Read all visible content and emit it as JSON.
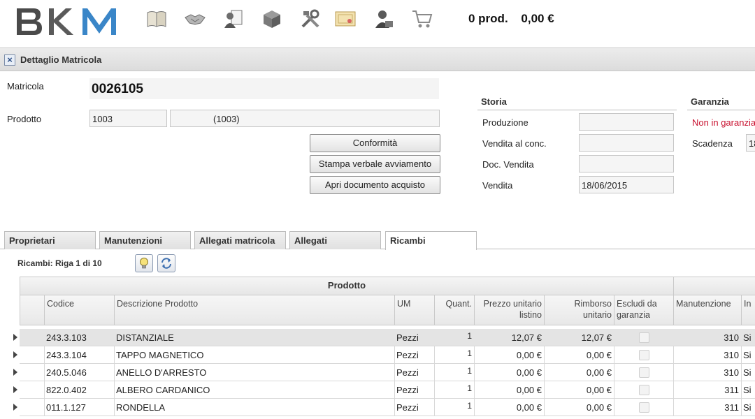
{
  "header": {
    "logo_text": "BKM",
    "nav_icons": [
      "catalog-book-icon",
      "handshake-icon",
      "document-person-icon",
      "box-icon",
      "tools-icon",
      "certificate-icon",
      "support-agent-icon",
      "cart-icon"
    ],
    "cart_count": "0 prod.",
    "cart_total": "0,00 €"
  },
  "window": {
    "title": "Dettaglio Matricola"
  },
  "detail": {
    "matricola_label": "Matricola",
    "matricola_value": "0026105",
    "prodotto_label": "Prodotto",
    "prodotto_code": "1003",
    "prodotto_desc": "(1003)"
  },
  "buttons": {
    "conformita": "Conformità",
    "stampa": "Stampa verbale avviamento",
    "apri": "Apri documento acquisto"
  },
  "storia": {
    "title": "Storia",
    "produzione_label": "Produzione",
    "produzione_value": "",
    "vendita_conc_label": "Vendita al conc.",
    "vendita_conc_value": "",
    "doc_vendita_label": "Doc. Vendita",
    "doc_vendita_value": "",
    "vendita_label": "Vendita",
    "vendita_value": "18/06/2015"
  },
  "garanzia": {
    "title": "Garanzia",
    "status": "Non in garanzia",
    "scadenza_label": "Scadenza",
    "scadenza_value": "18"
  },
  "tabs": [
    "Proprietari",
    "Manutenzioni",
    "Allegati matricola",
    "Allegati",
    "Ricambi"
  ],
  "active_tab": "Ricambi",
  "grid": {
    "title": "Ricambi: Riga 1 di 10",
    "group_header": "Prodotto",
    "columns": {
      "codice": "Codice",
      "descrizione": "Descrizione Prodotto",
      "um": "UM",
      "quant": "Quant.",
      "prezzo": "Prezzo unitario listino",
      "rimborso": "Rimborso unitario",
      "escludi": "Escludi da garanzia",
      "manutenzione": "Manutenzione",
      "in": "In"
    },
    "rows": [
      {
        "codice": "243.3.103",
        "descrizione": "DISTANZIALE",
        "um": "Pezzi",
        "quant": "1",
        "prezzo": "12,07 €",
        "rimborso": "12,07 €",
        "manutenzione": "310",
        "in": "Si"
      },
      {
        "codice": "243.3.104",
        "descrizione": "TAPPO MAGNETICO",
        "um": "Pezzi",
        "quant": "1",
        "prezzo": "0,00 €",
        "rimborso": "0,00 €",
        "manutenzione": "310",
        "in": "Si"
      },
      {
        "codice": "240.5.046",
        "descrizione": "ANELLO D'ARRESTO",
        "um": "Pezzi",
        "quant": "1",
        "prezzo": "0,00 €",
        "rimborso": "0,00 €",
        "manutenzione": "310",
        "in": "Si"
      },
      {
        "codice": "822.0.402",
        "descrizione": "ALBERO CARDANICO",
        "um": "Pezzi",
        "quant": "1",
        "prezzo": "0,00 €",
        "rimborso": "0,00 €",
        "manutenzione": "311",
        "in": "Si"
      },
      {
        "codice": "011.1.127",
        "descrizione": "RONDELLA",
        "um": "Pezzi",
        "quant": "1",
        "prezzo": "0,00 €",
        "rimborso": "0,00 €",
        "manutenzione": "311",
        "in": "Si"
      }
    ]
  },
  "colors": {
    "logo_dark": "#4a4a4a",
    "logo_blue": "#3a86c8",
    "warning_red": "#c8102e"
  }
}
